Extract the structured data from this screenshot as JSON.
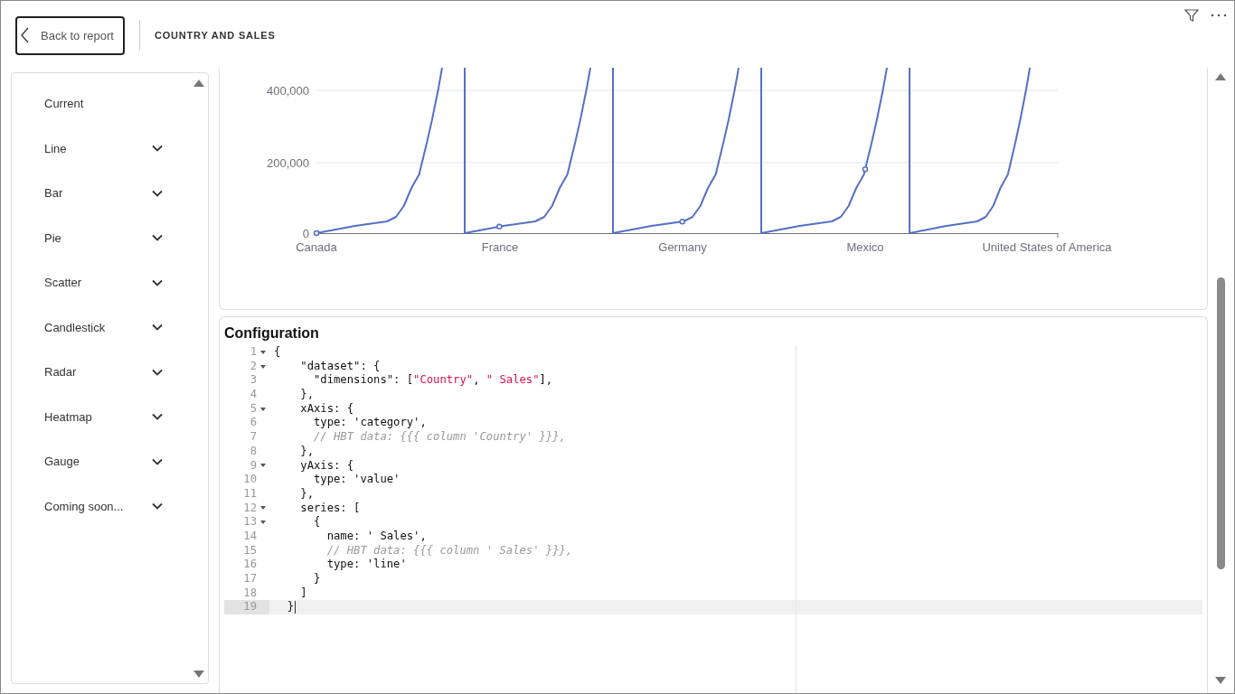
{
  "header": {
    "back_button": "Back to report",
    "title": "COUNTRY AND SALES"
  },
  "sidebar": {
    "items": [
      {
        "label": "Current",
        "kind": "plain"
      },
      {
        "label": "Line",
        "kind": "dropdown"
      },
      {
        "label": "Bar",
        "kind": "dropdown"
      },
      {
        "label": "Pie",
        "kind": "dropdown"
      },
      {
        "label": "Scatter",
        "kind": "dropdown"
      },
      {
        "label": "Candlestick",
        "kind": "dropdown"
      },
      {
        "label": "Radar",
        "kind": "dropdown"
      },
      {
        "label": "Heatmap",
        "kind": "dropdown"
      },
      {
        "label": "Gauge",
        "kind": "dropdown"
      },
      {
        "label": "Coming soon...",
        "kind": "dropdown"
      }
    ]
  },
  "chart": {
    "y_axis_labels": [
      "400,000",
      "200,000",
      "0"
    ],
    "x_axis_labels": [
      "Canada",
      "France",
      "Germany",
      "Mexico",
      "United States of America"
    ]
  },
  "config": {
    "title": "Configuration",
    "lines": [
      {
        "number": "1",
        "fold": true,
        "active": false,
        "segments": [
          {
            "kind": "plain",
            "text": "{"
          }
        ]
      },
      {
        "number": "2",
        "fold": true,
        "active": false,
        "segments": [
          {
            "kind": "plain",
            "text": "    \"dataset\": {"
          }
        ]
      },
      {
        "number": "3",
        "fold": false,
        "active": false,
        "segments": [
          {
            "kind": "plain",
            "text": "      \"dimensions\": ["
          },
          {
            "kind": "string",
            "text": "\"Country\""
          },
          {
            "kind": "plain",
            "text": ", "
          },
          {
            "kind": "string",
            "text": "\" Sales\""
          },
          {
            "kind": "plain",
            "text": "],"
          }
        ]
      },
      {
        "number": "4",
        "fold": false,
        "active": false,
        "segments": [
          {
            "kind": "plain",
            "text": "    },"
          }
        ]
      },
      {
        "number": "5",
        "fold": true,
        "active": false,
        "segments": [
          {
            "kind": "plain",
            "text": "    xAxis: {"
          }
        ]
      },
      {
        "number": "6",
        "fold": false,
        "active": false,
        "segments": [
          {
            "kind": "plain",
            "text": "      type: 'category',"
          }
        ]
      },
      {
        "number": "7",
        "fold": false,
        "active": false,
        "segments": [
          {
            "kind": "comment",
            "text": "      // HBT data: {{{ column 'Country' }}},"
          }
        ]
      },
      {
        "number": "8",
        "fold": false,
        "active": false,
        "segments": [
          {
            "kind": "plain",
            "text": "    },"
          }
        ]
      },
      {
        "number": "9",
        "fold": true,
        "active": false,
        "segments": [
          {
            "kind": "plain",
            "text": "    yAxis: {"
          }
        ]
      },
      {
        "number": "10",
        "fold": false,
        "active": false,
        "segments": [
          {
            "kind": "plain",
            "text": "      type: 'value'"
          }
        ]
      },
      {
        "number": "11",
        "fold": false,
        "active": false,
        "segments": [
          {
            "kind": "plain",
            "text": "    },"
          }
        ]
      },
      {
        "number": "12",
        "fold": true,
        "active": false,
        "segments": [
          {
            "kind": "plain",
            "text": "    series: ["
          }
        ]
      },
      {
        "number": "13",
        "fold": true,
        "active": false,
        "segments": [
          {
            "kind": "plain",
            "text": "      {"
          }
        ]
      },
      {
        "number": "14",
        "fold": false,
        "active": false,
        "segments": [
          {
            "kind": "plain",
            "text": "        name: ' Sales',"
          }
        ]
      },
      {
        "number": "15",
        "fold": false,
        "active": false,
        "segments": [
          {
            "kind": "comment",
            "text": "        // HBT data: {{{ column ' Sales' }}},"
          }
        ]
      },
      {
        "number": "16",
        "fold": false,
        "active": false,
        "segments": [
          {
            "kind": "plain",
            "text": "        type: 'line'"
          }
        ]
      },
      {
        "number": "17",
        "fold": false,
        "active": false,
        "segments": [
          {
            "kind": "plain",
            "text": "      }"
          }
        ]
      },
      {
        "number": "18",
        "fold": false,
        "active": false,
        "segments": [
          {
            "kind": "plain",
            "text": "    ]"
          }
        ]
      },
      {
        "number": "19",
        "fold": false,
        "active": true,
        "segments": [
          {
            "kind": "plain",
            "text": "  }"
          }
        ]
      }
    ]
  }
}
